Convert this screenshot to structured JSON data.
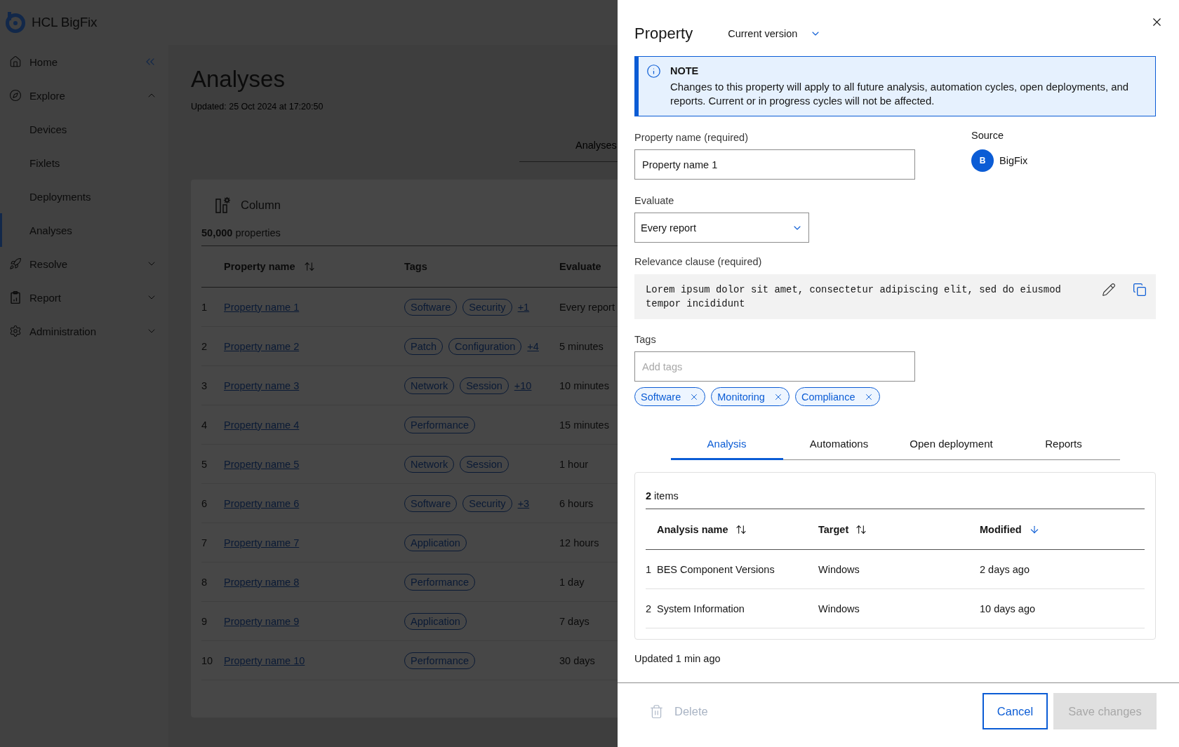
{
  "app": {
    "logo": "HCL BigFix"
  },
  "sidebar": {
    "items": [
      {
        "label": "Home",
        "selected": false
      },
      {
        "label": "Explore",
        "selected": false,
        "expanded": true,
        "children": [
          {
            "label": "Devices",
            "selected": false
          },
          {
            "label": "Fixlets",
            "selected": false
          },
          {
            "label": "Deployments",
            "selected": false
          },
          {
            "label": "Analyses",
            "selected": true
          }
        ]
      },
      {
        "label": "Resolve",
        "selected": false,
        "expanded": false
      },
      {
        "label": "Report",
        "selected": false,
        "expanded": false
      },
      {
        "label": "Administration",
        "selected": false,
        "expanded": false
      }
    ]
  },
  "page": {
    "title": "Analyses",
    "updated": "Updated: 25 Oct 2024 at 17:20:50",
    "tabs": [
      {
        "label": "Analyses",
        "selected": false
      }
    ],
    "card": {
      "column_button": "Column",
      "count": "**50,000** properties",
      "columns": [
        {
          "label": "Property name",
          "sortable": true,
          "sorted": false
        },
        {
          "label": "Tags",
          "sortable": false
        },
        {
          "label": "Evaluate",
          "sortable": false
        }
      ],
      "rows": [
        {
          "number": "1",
          "name": "Property name 1",
          "tags": [
            "Software",
            "Security"
          ],
          "more": "+1",
          "evaluate": "Every report"
        },
        {
          "number": "2",
          "name": "Property name 2",
          "tags": [
            "Patch",
            "Configuration"
          ],
          "more": "+4",
          "evaluate": "5 minutes"
        },
        {
          "number": "3",
          "name": "Property name 3",
          "tags": [
            "Network",
            "Session"
          ],
          "more": "+10",
          "evaluate": "10 minutes"
        },
        {
          "number": "4",
          "name": "Property name 4",
          "tags": [
            "Performance"
          ],
          "evaluate": "15 minutes"
        },
        {
          "number": "5",
          "name": "Property name 5",
          "tags": [
            "Network",
            "Session"
          ],
          "evaluate": "1 hour"
        },
        {
          "number": "6",
          "name": "Property name 6",
          "tags": [
            "Software",
            "Security"
          ],
          "more": "+3",
          "evaluate": "6 hours"
        },
        {
          "number": "7",
          "name": "Property name 7",
          "tags": [
            "Application"
          ],
          "evaluate": "12 hours"
        },
        {
          "number": "8",
          "name": "Property name 8",
          "tags": [
            "Performance"
          ],
          "evaluate": "1 day"
        },
        {
          "number": "9",
          "name": "Property name 9",
          "tags": [
            "Application"
          ],
          "evaluate": "7 days"
        },
        {
          "number": "10",
          "name": "Property name 10",
          "tags": [
            "Performance"
          ],
          "evaluate": "30 days"
        }
      ]
    }
  },
  "drawer": {
    "title": "Property",
    "version": "Current version",
    "note": {
      "title": "NOTE",
      "text": "Changes to this property will apply to all future analysis, automation cycles, open deployments, and reports. Current or in progress cycles will not be affected."
    },
    "property_name": {
      "label": "Property name (required)",
      "value": "Property name 1"
    },
    "source": {
      "label": "Source",
      "avatar": "B",
      "name": "BigFix"
    },
    "evaluate": {
      "label": "Evaluate",
      "value": "Every report"
    },
    "relevance": {
      "label": "Relevance clause (required)",
      "code": "Lorem ipsum dolor sit amet, consectetur adipiscing elit, sed do eiusmod tempor incididunt"
    },
    "tags": {
      "label": "Tags",
      "placeholder": "Add tags",
      "chips": [
        "Software",
        "Monitoring",
        "Compliance"
      ]
    },
    "tabs": [
      {
        "label": "Analysis",
        "selected": true
      },
      {
        "label": "Automations",
        "selected": false
      },
      {
        "label": "Open deployment",
        "selected": false
      },
      {
        "label": "Reports",
        "selected": false
      }
    ],
    "table": {
      "count": "**2** items",
      "columns": [
        {
          "label": "Analysis name",
          "sortable": true,
          "sorted": false
        },
        {
          "label": "Target",
          "sortable": true,
          "sorted": false
        },
        {
          "label": "Modified",
          "sortable": true,
          "sorted": true
        }
      ],
      "rows": [
        {
          "number": "1",
          "cells": [
            "BES Component Versions",
            "Windows",
            "2 days ago"
          ]
        },
        {
          "number": "2",
          "cells": [
            "System Information",
            "Windows",
            "10 days ago"
          ]
        }
      ]
    },
    "updated": "Updated 1 min ago",
    "footer": {
      "delete": {
        "label": "Delete",
        "disabled": true
      },
      "cancel": {
        "label": "Cancel"
      },
      "save": {
        "label": "Save changes",
        "disabled": true
      }
    }
  }
}
